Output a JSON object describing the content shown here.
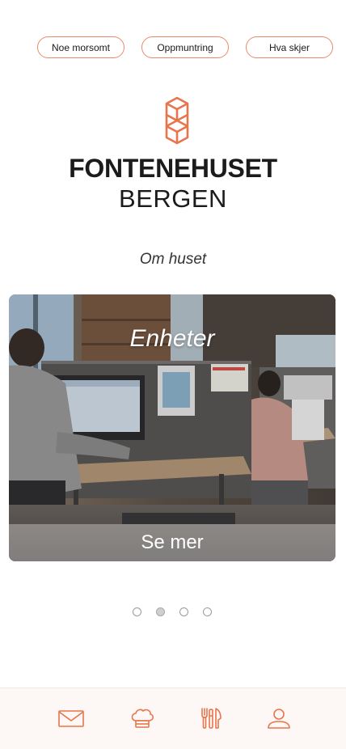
{
  "chips": [
    {
      "label": "Noe morsomt"
    },
    {
      "label": "Oppmuntring"
    },
    {
      "label": "Hva skjer"
    }
  ],
  "logo": {
    "title": "FONTENEHUSET",
    "subtitle": "BERGEN",
    "mark_icon": "hexagon-cubes-icon"
  },
  "about_link": "Om huset",
  "carousel": {
    "card_title": "Enheter",
    "cta_label": "Se mer",
    "page_count": 4,
    "active_index": 1
  },
  "tabbar": {
    "items": [
      {
        "icon": "envelope-icon"
      },
      {
        "icon": "chef-hat-icon"
      },
      {
        "icon": "fork-knife-icon"
      },
      {
        "icon": "user-icon"
      }
    ]
  },
  "colors": {
    "accent": "#e8754a",
    "chip_border": "#e8896a",
    "text": "#1b1b1b"
  }
}
